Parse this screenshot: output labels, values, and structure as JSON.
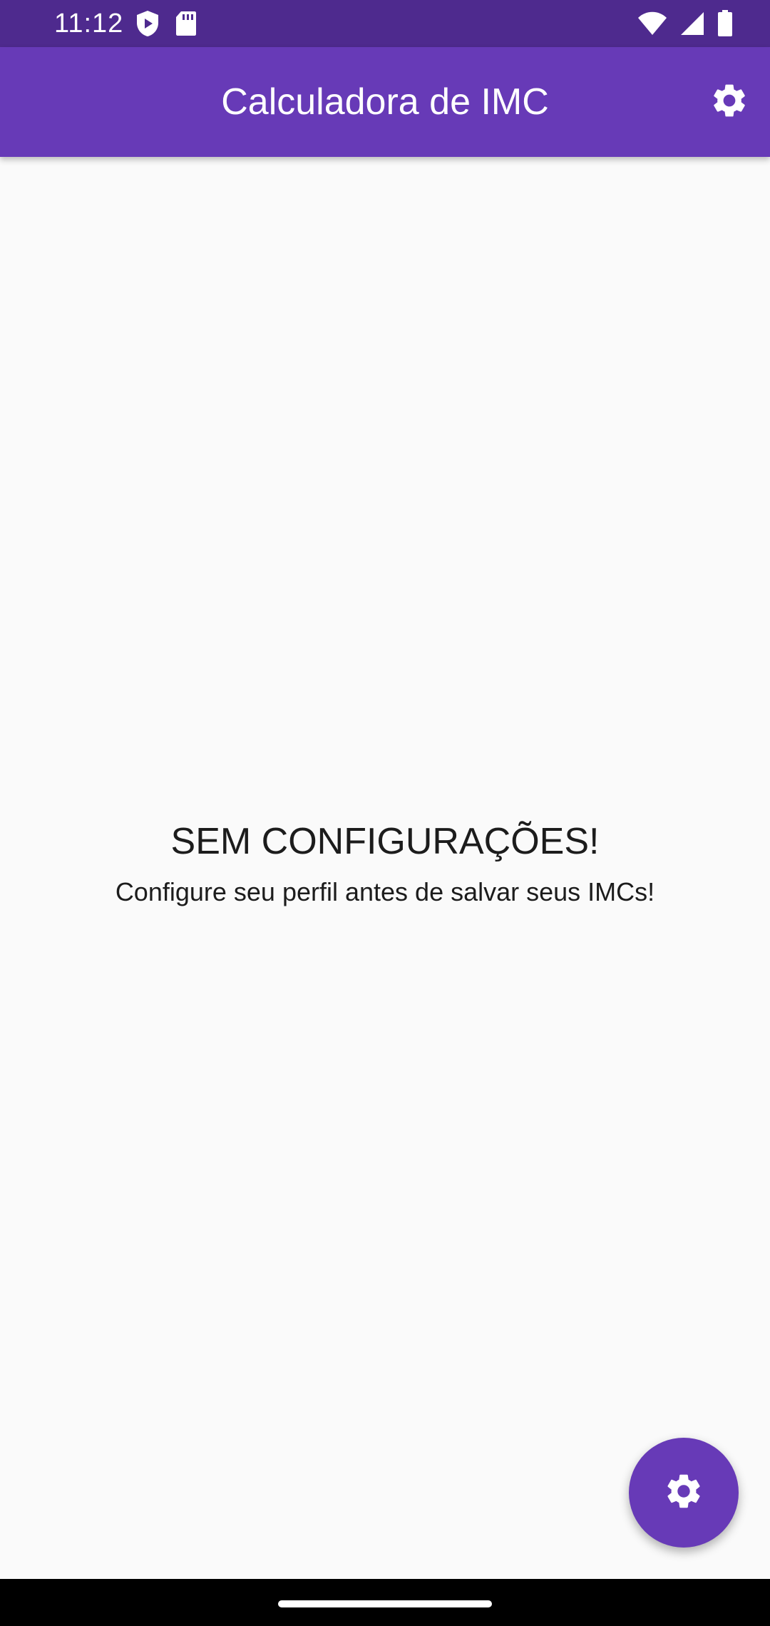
{
  "status_bar": {
    "time": "11:12",
    "left_icons": [
      "play-protect-icon",
      "sd-card-icon"
    ],
    "right_icons": [
      "wifi-icon",
      "cell-signal-icon",
      "battery-icon"
    ]
  },
  "app_bar": {
    "title": "Calculadora de IMC",
    "action_icon": "gear-icon"
  },
  "empty_state": {
    "title": "SEM CONFIGURAÇÕES!",
    "subtitle": "Configure seu perfil antes de salvar seus IMCs!"
  },
  "fab": {
    "icon": "gear-icon"
  },
  "colors": {
    "status_bar": "#4e2a8e",
    "app_bar": "#673ab7",
    "background": "#fafafa",
    "fab": "#673ab7"
  }
}
